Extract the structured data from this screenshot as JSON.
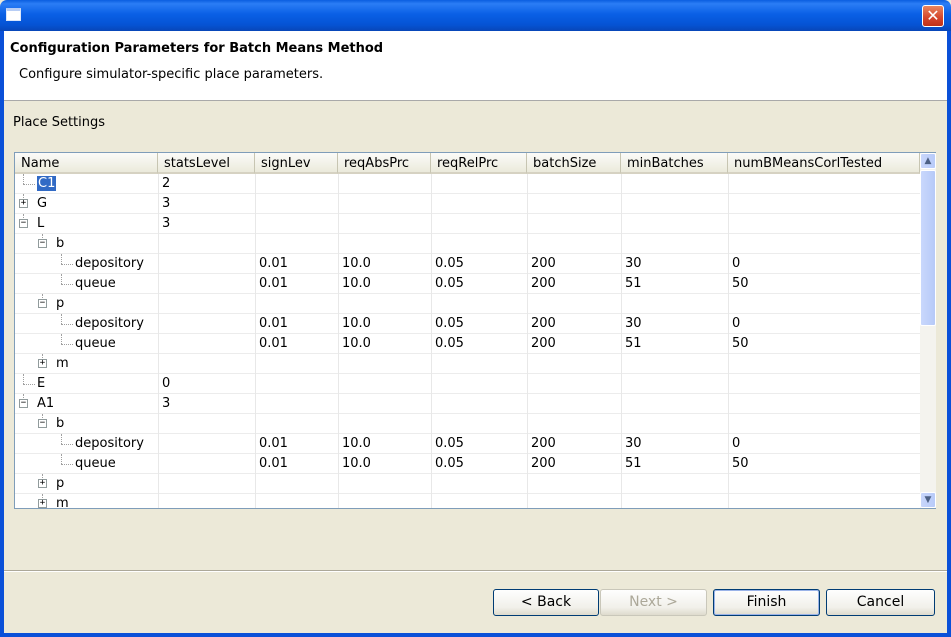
{
  "window": {
    "title": ""
  },
  "header": {
    "title": "Configuration Parameters for Batch Means Method",
    "description": "Configure simulator-specific place parameters."
  },
  "section": {
    "label": "Place Settings"
  },
  "table": {
    "columns": [
      "Name",
      "statsLevel",
      "signLev",
      "reqAbsPrc",
      "reqRelPrc",
      "batchSize",
      "minBatches",
      "numBMeansCorlTested"
    ],
    "rows": [
      {
        "name": "C1",
        "depth": 0,
        "toggle": "",
        "selected": true,
        "statsLevel": "2",
        "signLev": "",
        "reqAbsPrc": "",
        "reqRelPrc": "",
        "batchSize": "",
        "minBatches": "",
        "numBMeansCorlTested": ""
      },
      {
        "name": "G",
        "depth": 0,
        "toggle": "+",
        "statsLevel": "3",
        "signLev": "",
        "reqAbsPrc": "",
        "reqRelPrc": "",
        "batchSize": "",
        "minBatches": "",
        "numBMeansCorlTested": ""
      },
      {
        "name": "L",
        "depth": 0,
        "toggle": "-",
        "statsLevel": "3",
        "signLev": "",
        "reqAbsPrc": "",
        "reqRelPrc": "",
        "batchSize": "",
        "minBatches": "",
        "numBMeansCorlTested": ""
      },
      {
        "name": "b",
        "depth": 1,
        "toggle": "-",
        "statsLevel": "",
        "signLev": "",
        "reqAbsPrc": "",
        "reqRelPrc": "",
        "batchSize": "",
        "minBatches": "",
        "numBMeansCorlTested": ""
      },
      {
        "name": "depository",
        "depth": 2,
        "toggle": "",
        "statsLevel": "",
        "signLev": "0.01",
        "reqAbsPrc": "10.0",
        "reqRelPrc": "0.05",
        "batchSize": "200",
        "minBatches": "30",
        "numBMeansCorlTested": "0"
      },
      {
        "name": "queue",
        "depth": 2,
        "toggle": "",
        "statsLevel": "",
        "signLev": "0.01",
        "reqAbsPrc": "10.0",
        "reqRelPrc": "0.05",
        "batchSize": "200",
        "minBatches": "51",
        "numBMeansCorlTested": "50"
      },
      {
        "name": "p",
        "depth": 1,
        "toggle": "-",
        "statsLevel": "",
        "signLev": "",
        "reqAbsPrc": "",
        "reqRelPrc": "",
        "batchSize": "",
        "minBatches": "",
        "numBMeansCorlTested": ""
      },
      {
        "name": "depository",
        "depth": 2,
        "toggle": "",
        "statsLevel": "",
        "signLev": "0.01",
        "reqAbsPrc": "10.0",
        "reqRelPrc": "0.05",
        "batchSize": "200",
        "minBatches": "30",
        "numBMeansCorlTested": "0"
      },
      {
        "name": "queue",
        "depth": 2,
        "toggle": "",
        "statsLevel": "",
        "signLev": "0.01",
        "reqAbsPrc": "10.0",
        "reqRelPrc": "0.05",
        "batchSize": "200",
        "minBatches": "51",
        "numBMeansCorlTested": "50"
      },
      {
        "name": "m",
        "depth": 1,
        "toggle": "+",
        "statsLevel": "",
        "signLev": "",
        "reqAbsPrc": "",
        "reqRelPrc": "",
        "batchSize": "",
        "minBatches": "",
        "numBMeansCorlTested": ""
      },
      {
        "name": "E",
        "depth": 0,
        "toggle": "",
        "statsLevel": "0",
        "signLev": "",
        "reqAbsPrc": "",
        "reqRelPrc": "",
        "batchSize": "",
        "minBatches": "",
        "numBMeansCorlTested": ""
      },
      {
        "name": "A1",
        "depth": 0,
        "toggle": "-",
        "statsLevel": "3",
        "signLev": "",
        "reqAbsPrc": "",
        "reqRelPrc": "",
        "batchSize": "",
        "minBatches": "",
        "numBMeansCorlTested": ""
      },
      {
        "name": "b",
        "depth": 1,
        "toggle": "-",
        "statsLevel": "",
        "signLev": "",
        "reqAbsPrc": "",
        "reqRelPrc": "",
        "batchSize": "",
        "minBatches": "",
        "numBMeansCorlTested": ""
      },
      {
        "name": "depository",
        "depth": 2,
        "toggle": "",
        "statsLevel": "",
        "signLev": "0.01",
        "reqAbsPrc": "10.0",
        "reqRelPrc": "0.05",
        "batchSize": "200",
        "minBatches": "30",
        "numBMeansCorlTested": "0"
      },
      {
        "name": "queue",
        "depth": 2,
        "toggle": "",
        "statsLevel": "",
        "signLev": "0.01",
        "reqAbsPrc": "10.0",
        "reqRelPrc": "0.05",
        "batchSize": "200",
        "minBatches": "51",
        "numBMeansCorlTested": "50"
      },
      {
        "name": "p",
        "depth": 1,
        "toggle": "+",
        "statsLevel": "",
        "signLev": "",
        "reqAbsPrc": "",
        "reqRelPrc": "",
        "batchSize": "",
        "minBatches": "",
        "numBMeansCorlTested": ""
      },
      {
        "name": "m",
        "depth": 1,
        "toggle": "+",
        "statsLevel": "",
        "signLev": "",
        "reqAbsPrc": "",
        "reqRelPrc": "",
        "batchSize": "",
        "minBatches": "",
        "numBMeansCorlTested": ""
      }
    ]
  },
  "icons": {
    "close": "close-icon",
    "scroll_up": "arrow-up-icon",
    "scroll_down": "arrow-down-icon",
    "expand": "plus-icon",
    "collapse": "minus-icon"
  },
  "colors": {
    "titlebar": "#0a5ee0",
    "selection": "#316ac5",
    "dialog_bg": "#ece9d8"
  },
  "buttons": {
    "back": "< Back",
    "next": "Next >",
    "finish": "Finish",
    "cancel": "Cancel"
  }
}
